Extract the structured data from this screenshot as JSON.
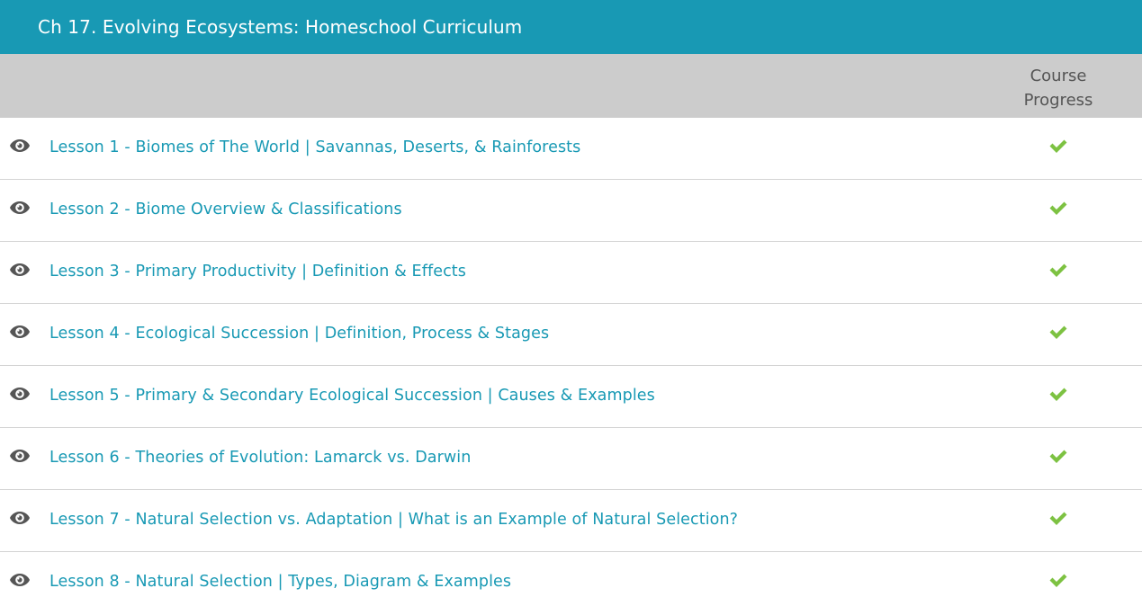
{
  "header": {
    "title": "Ch 17. Evolving Ecosystems: Homeschool Curriculum"
  },
  "columns": {
    "progress_line1": "Course",
    "progress_line2": "Progress"
  },
  "lessons": [
    {
      "label": "Lesson 1 - Biomes of The World | Savannas, Deserts, & Rainforests",
      "completed": true
    },
    {
      "label": "Lesson 2 - Biome Overview & Classifications",
      "completed": true
    },
    {
      "label": "Lesson 3 - Primary Productivity | Definition & Effects",
      "completed": true
    },
    {
      "label": "Lesson 4 - Ecological Succession | Definition, Process & Stages",
      "completed": true
    },
    {
      "label": "Lesson 5 - Primary & Secondary Ecological Succession | Causes & Examples",
      "completed": true
    },
    {
      "label": "Lesson 6 - Theories of Evolution: Lamarck vs. Darwin",
      "completed": true
    },
    {
      "label": "Lesson 7 - Natural Selection vs. Adaptation | What is an Example of Natural Selection?",
      "completed": true
    },
    {
      "label": "Lesson 8 - Natural Selection | Types, Diagram & Examples",
      "completed": true
    }
  ],
  "colors": {
    "header_bg": "#1899b4",
    "link": "#1899b4",
    "check": "#7dc242",
    "eye": "#555555",
    "subheader_bg": "#cccccc"
  },
  "icons": {
    "preview": "eye-icon",
    "status": "checkmark-icon"
  }
}
